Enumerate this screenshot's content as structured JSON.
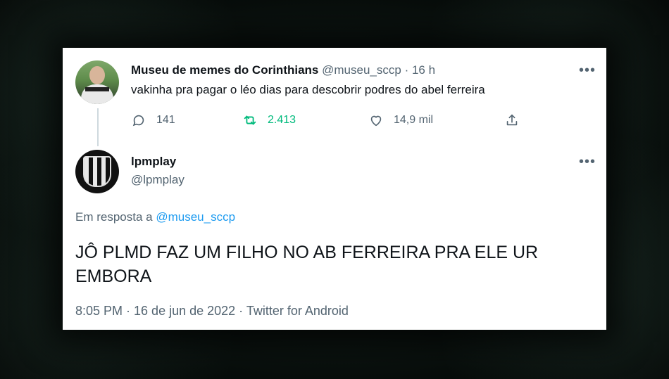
{
  "tweet1": {
    "name": "Museu de memes do Corinthians",
    "handle": "@museu_sccp",
    "separator": "·",
    "time": "16 h",
    "text": "vakinha pra pagar o léo dias para descobrir podres do abel ferreira",
    "more": "•••",
    "actions": {
      "replies": "141",
      "retweets": "2.413",
      "likes": "14,9 mil"
    }
  },
  "tweet2": {
    "name": "lpmplay",
    "handle": "@lpmplay",
    "more": "•••",
    "reply_prefix": "Em resposta a ",
    "reply_mention": "@museu_sccp",
    "text": "JÔ PLMD FAZ UM FILHO NO AB FERREIRA PRA ELE UR EMBORA",
    "meta": "8:05 PM · 16 de jun de 2022 · Twitter for Android"
  },
  "colors": {
    "text": "#0f1419",
    "secondary": "#536471",
    "link": "#1d9bf0",
    "retweet": "#00ba7c"
  },
  "icons": [
    "reply-icon",
    "retweet-icon",
    "like-icon",
    "share-icon",
    "more-icon"
  ]
}
